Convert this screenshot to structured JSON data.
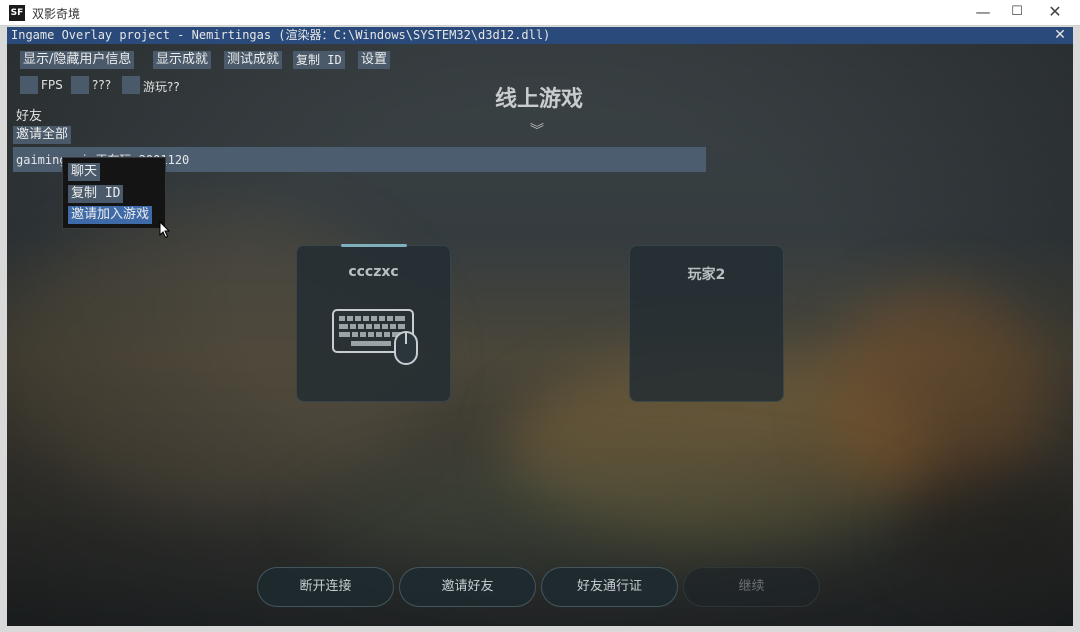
{
  "window": {
    "icon_text": "SF",
    "title": "双影奇境",
    "minimize": "—",
    "maximize": "☐",
    "close": "✕"
  },
  "overlay": {
    "header": "Ingame Overlay project - Nemirtingas (渲染器：C:\\Windows\\SYSTEM32\\d3d12.dll)",
    "close": "✕",
    "toolbar": [
      "显示/隐藏用户信息",
      "显示成就",
      "测试成就",
      "复制 ID",
      "设置"
    ],
    "checkboxes": [
      {
        "label": "FPS",
        "checked": false
      },
      {
        "label": "???",
        "checked": false
      },
      {
        "label": "游玩??",
        "checked": false
      }
    ],
    "friends_label": "好友",
    "invite_all": "邀请全部",
    "friend_row_text": "gaiminggai 正在玩 2001120",
    "context_menu": [
      "聊天",
      "复制 ID",
      "邀请加入游戏"
    ]
  },
  "game": {
    "title": "线上游戏",
    "players": [
      {
        "name": "ccczxc",
        "device_icon": "keyboard-mouse-icon"
      },
      {
        "name": "玩家2"
      }
    ],
    "buttons": {
      "disconnect": "断开连接",
      "invite_friends": "邀请好友",
      "friend_pass": "好友通行证",
      "continue": "继续"
    }
  },
  "colors": {
    "overlay_header": "#294a7a",
    "overlay_button": "#4a5a6a",
    "menu_highlight": "#3f6aa8"
  }
}
